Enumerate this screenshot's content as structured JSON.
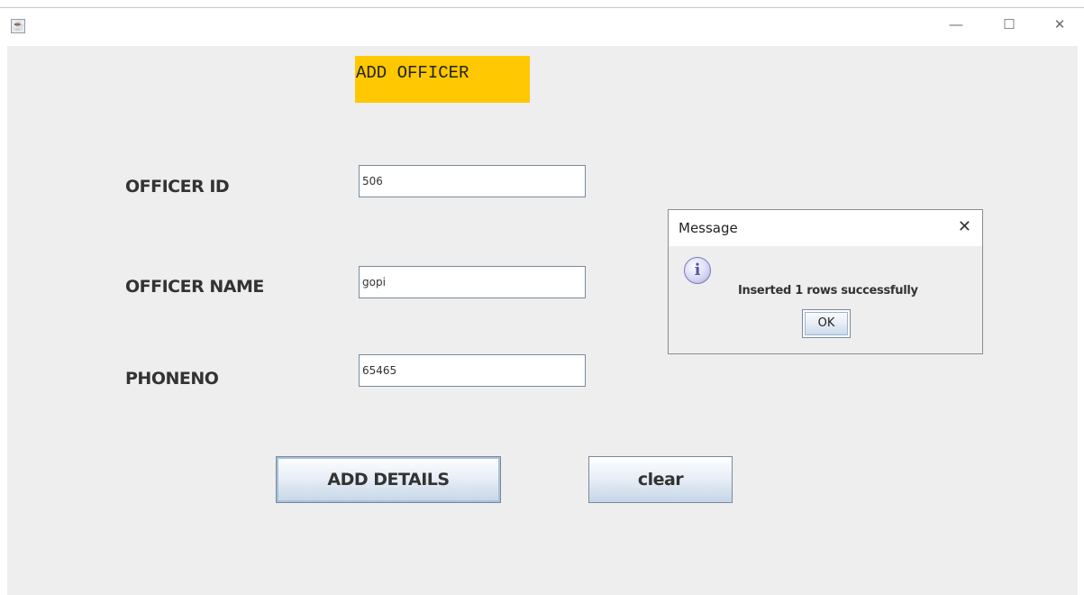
{
  "window": {
    "app_icon": "java-cup-icon",
    "controls": {
      "minimize": "—",
      "maximize": "☐",
      "close": "✕"
    }
  },
  "form": {
    "heading": "ADD OFFICER",
    "heading_color": "#ffc800",
    "fields": [
      {
        "label": "OFFICER ID",
        "value": "506"
      },
      {
        "label": "OFFICER NAME",
        "value": "gopi"
      },
      {
        "label": "PHONENO",
        "value": "65465"
      }
    ],
    "add_button_label": "ADD DETAILS",
    "clear_button_label": "clear"
  },
  "dialog": {
    "title": "Message",
    "close_glyph": "✕",
    "icon": "information-icon",
    "icon_glyph": "i",
    "message": "Inserted 1 rows successfully",
    "ok_label": "OK"
  }
}
